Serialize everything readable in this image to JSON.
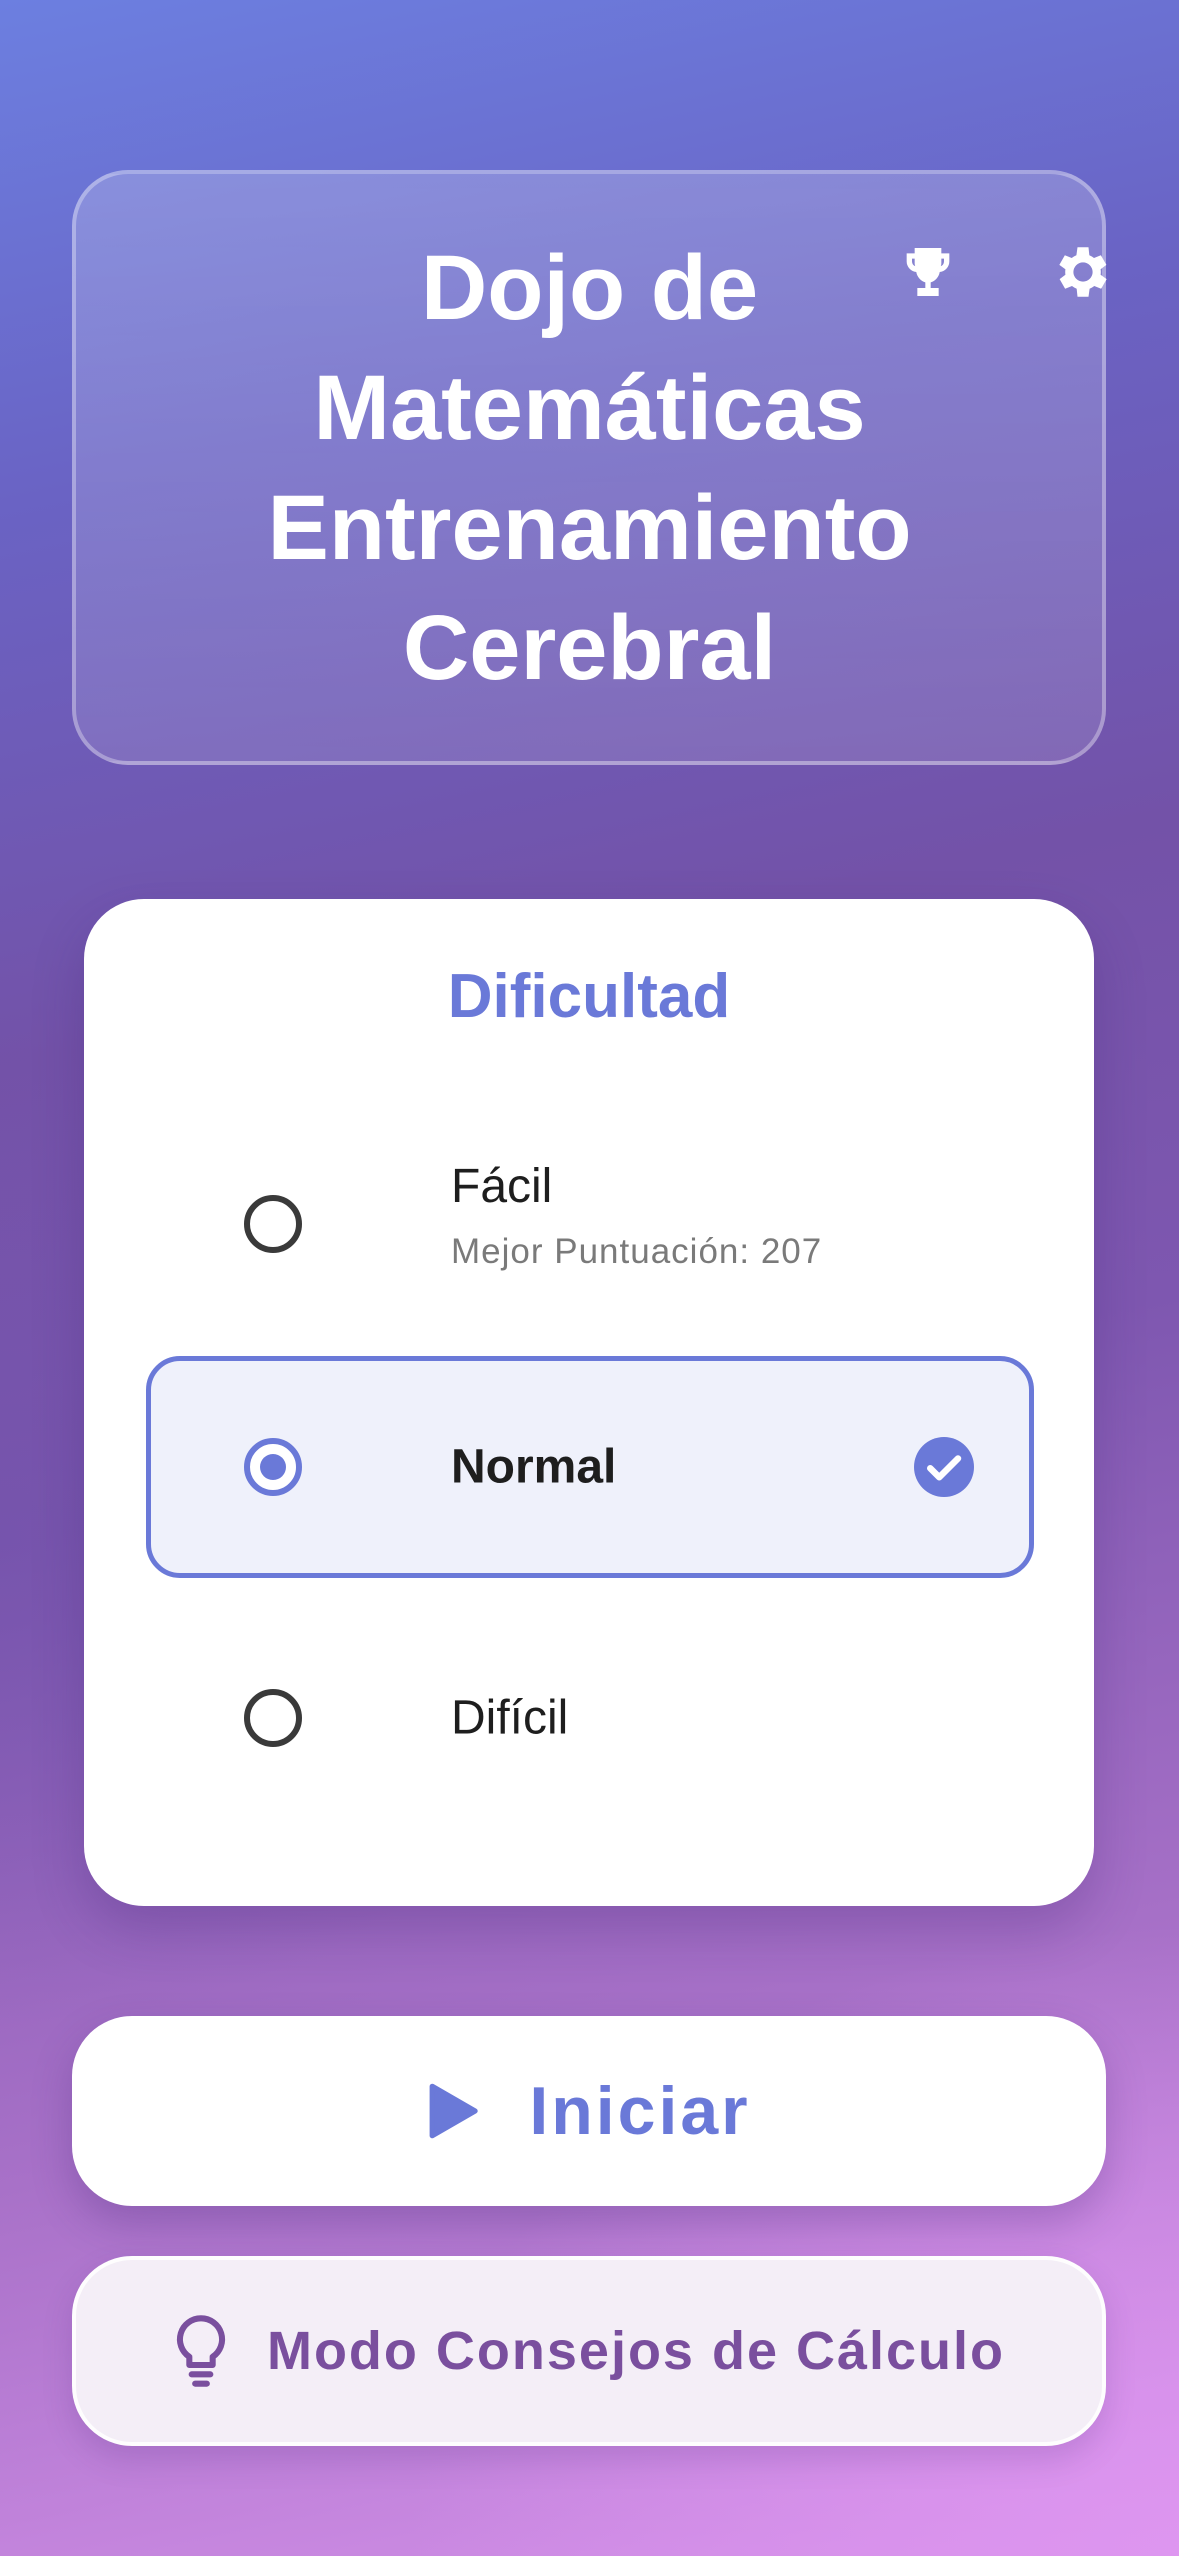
{
  "header": {
    "title_lines": [
      "Dojo de",
      "Matemáticas",
      "Entrenamiento",
      "Cerebral"
    ],
    "trophy_icon": "trophy-icon",
    "settings_icon": "gear-icon"
  },
  "difficulty": {
    "title": "Dificultad",
    "options": [
      {
        "label": "Fácil",
        "subtitle": "Mejor Puntuación: 207",
        "selected": false
      },
      {
        "label": "Normal",
        "subtitle": "",
        "selected": true
      },
      {
        "label": "Difícil",
        "subtitle": "",
        "selected": false
      }
    ]
  },
  "actions": {
    "start_label": "Iniciar",
    "start_icon": "play-icon",
    "tips_label": "Modo Consejos de Cálculo",
    "tips_icon": "lightbulb-icon"
  },
  "colors": {
    "accent": "#6a79d8",
    "tips_text": "#7a4f9e",
    "card_background": "#ffffff"
  }
}
